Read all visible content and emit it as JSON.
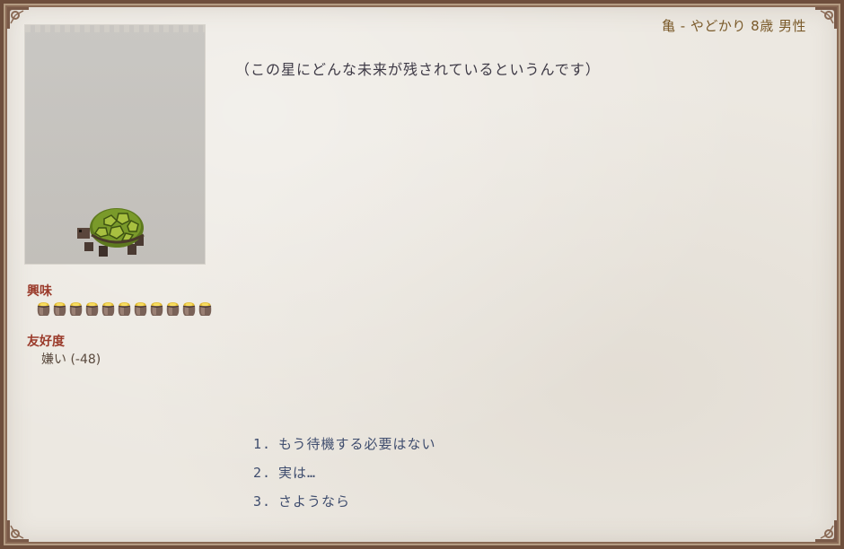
{
  "header": {
    "title": "亀 - やどかり 8歳 男性"
  },
  "portrait": {
    "icon": "turtle-sprite"
  },
  "stats": {
    "interest_label": "興味",
    "interest_level": 11,
    "interest_icon": "coin-pouch-icon",
    "friendship_label": "友好度",
    "friendship_value": "嫌い (-48)"
  },
  "dialogue": {
    "text": "（この星にどんな未来が残されているというんです）"
  },
  "choices": [
    {
      "number": "1.",
      "label": "もう待機する必要はない"
    },
    {
      "number": "2.",
      "label": "実は…"
    },
    {
      "number": "3.",
      "label": "さようなら"
    }
  ],
  "colors": {
    "header_text": "#7a5a2a",
    "stat_label": "#9a3a2a",
    "choice_text": "#3f4d6e",
    "paper": "#ece8e1",
    "frame": "#6e4e3c"
  }
}
